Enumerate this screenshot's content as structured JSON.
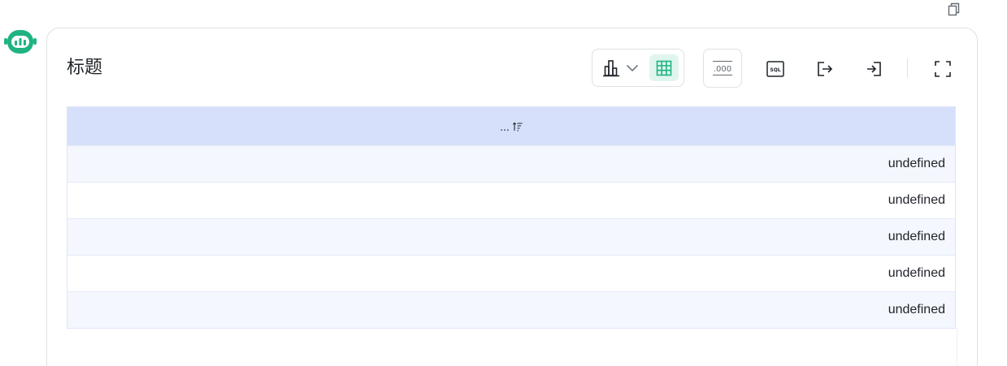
{
  "card": {
    "title": "标题"
  },
  "toolbar": {
    "icons": [
      "bar-chart-icon",
      "chevron-down-icon",
      "table-grid-icon",
      "number-format-icon",
      "sql-icon",
      "export-icon",
      "import-icon",
      "fullscreen-icon"
    ],
    "format_label": ".000",
    "sql_label": "SQL"
  },
  "table": {
    "header": "...",
    "rows": [
      "undefined",
      "undefined",
      "undefined",
      "undefined",
      "undefined"
    ]
  },
  "colors": {
    "accent": "#1fb381",
    "header_bg": "#d6e0fb",
    "row_alt_bg": "#f4f7fe"
  }
}
